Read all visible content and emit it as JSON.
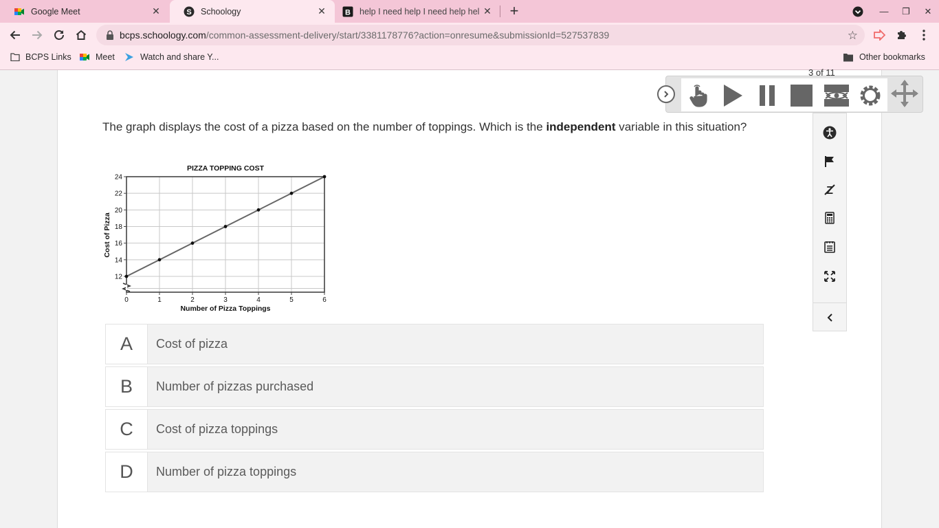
{
  "browser": {
    "tabs": [
      {
        "title": "Google Meet",
        "icon": "google-meet-icon"
      },
      {
        "title": "Schoology",
        "icon": "schoology-icon",
        "active": true
      },
      {
        "title": "help I need help I need help help",
        "icon": "brainly-icon"
      }
    ],
    "url_host": "bcps.schoology.com",
    "url_path": "/common-assessment-delivery/start/3381178776?action=onresume&submissionId=527537839",
    "bookmarks": [
      "BCPS Links",
      "Meet",
      "Watch and share Y..."
    ],
    "other_bookmarks": "Other bookmarks"
  },
  "assessment": {
    "counter": "3 of 11",
    "question_before": "The graph displays the cost of a pizza based on the number of toppings. Which is the ",
    "question_bold": "independent",
    "question_after": " variable in this situation?",
    "choices": [
      {
        "letter": "A",
        "text": "Cost of pizza"
      },
      {
        "letter": "B",
        "text": "Number of pizzas purchased"
      },
      {
        "letter": "C",
        "text": "Cost of pizza toppings"
      },
      {
        "letter": "D",
        "text": "Number of pizza toppings"
      }
    ]
  },
  "tools": {
    "sidebar": [
      "accessibility-icon",
      "flag-icon",
      "strikethrough-icon",
      "calculator-icon",
      "notepad-icon",
      "fullscreen-icon",
      "collapse-left-icon"
    ],
    "tts": [
      "collapse-icon",
      "pointer-icon",
      "play-icon",
      "pause-icon",
      "stop-icon",
      "screen-mask-icon",
      "settings-icon",
      "move-icon"
    ]
  },
  "chart_data": {
    "type": "line",
    "title": "PIZZA TOPPING COST",
    "xlabel": "Number of Pizza Toppings",
    "ylabel": "Cost of Pizza",
    "x": [
      0,
      1,
      2,
      3,
      4,
      5,
      6
    ],
    "y": [
      12,
      14,
      16,
      18,
      20,
      22,
      24
    ],
    "xticks": [
      0,
      1,
      2,
      3,
      4,
      5,
      6
    ],
    "yticks": [
      12,
      14,
      16,
      18,
      20,
      22,
      24
    ],
    "xlim": [
      0,
      6
    ],
    "ylim": [
      12,
      24
    ],
    "grid": true,
    "axis_break": true
  }
}
